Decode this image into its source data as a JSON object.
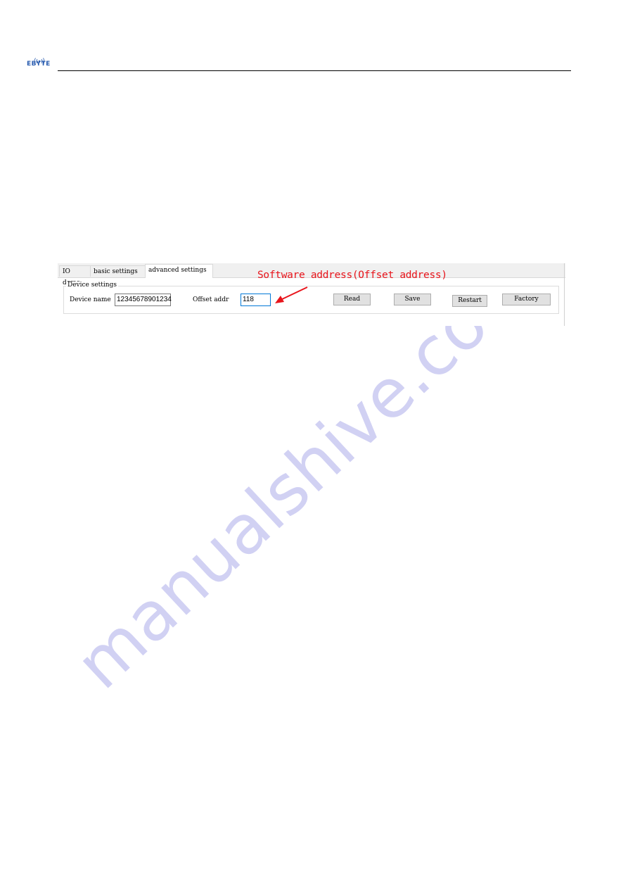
{
  "header": {
    "logo_text": "EBYTE"
  },
  "watermark": "manualshive.com",
  "screenshot": {
    "tabs": [
      {
        "label": "IO demo",
        "selected": false
      },
      {
        "label": "basic settings",
        "selected": false
      },
      {
        "label": "advanced settings",
        "selected": true
      }
    ],
    "group_label": "Device settings",
    "device_name_label": "Device name",
    "device_name_value": "12345678901234",
    "offset_addr_label": "Offset addr",
    "offset_addr_value": "118",
    "buttons": {
      "read": "Read",
      "save": "Save",
      "restart": "Restart",
      "factory": "Factory"
    }
  },
  "annotation": {
    "text": "Software address(Offset address)",
    "color": "#e8141b"
  }
}
